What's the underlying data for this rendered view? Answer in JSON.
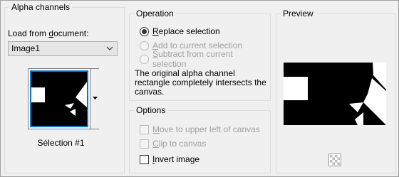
{
  "alpha": {
    "title": "Alpha channels",
    "load_label_pre": "Load from ",
    "load_label_u": "d",
    "load_label_post": "ocument:",
    "document_value": "Image1",
    "selection_label": "Sélection #1"
  },
  "operation": {
    "title": "Operation",
    "options": [
      {
        "u": "R",
        "rest": "eplace selection",
        "checked": true,
        "enabled": true
      },
      {
        "u": "A",
        "rest": "dd to current selection",
        "checked": false,
        "enabled": false
      },
      {
        "u": "S",
        "rest": "ubtract from current selection",
        "checked": false,
        "enabled": false
      }
    ],
    "info_text": "The original alpha channel rectangle completely intersects the canvas."
  },
  "options": {
    "title": "Options",
    "items": [
      {
        "u": "M",
        "rest": "ove to upper left of canvas",
        "checked": false,
        "enabled": false
      },
      {
        "u": "C",
        "rest": "lip to canvas",
        "checked": false,
        "enabled": false
      },
      {
        "u": "I",
        "rest": "nvert image",
        "checked": false,
        "enabled": true
      }
    ]
  },
  "preview": {
    "title": "Preview",
    "toggle_icon": "checkerboard-icon"
  },
  "colors": {
    "accent": "#0078d7",
    "background": "#f0f0f0",
    "disabled_text": "#a0a0a0"
  }
}
